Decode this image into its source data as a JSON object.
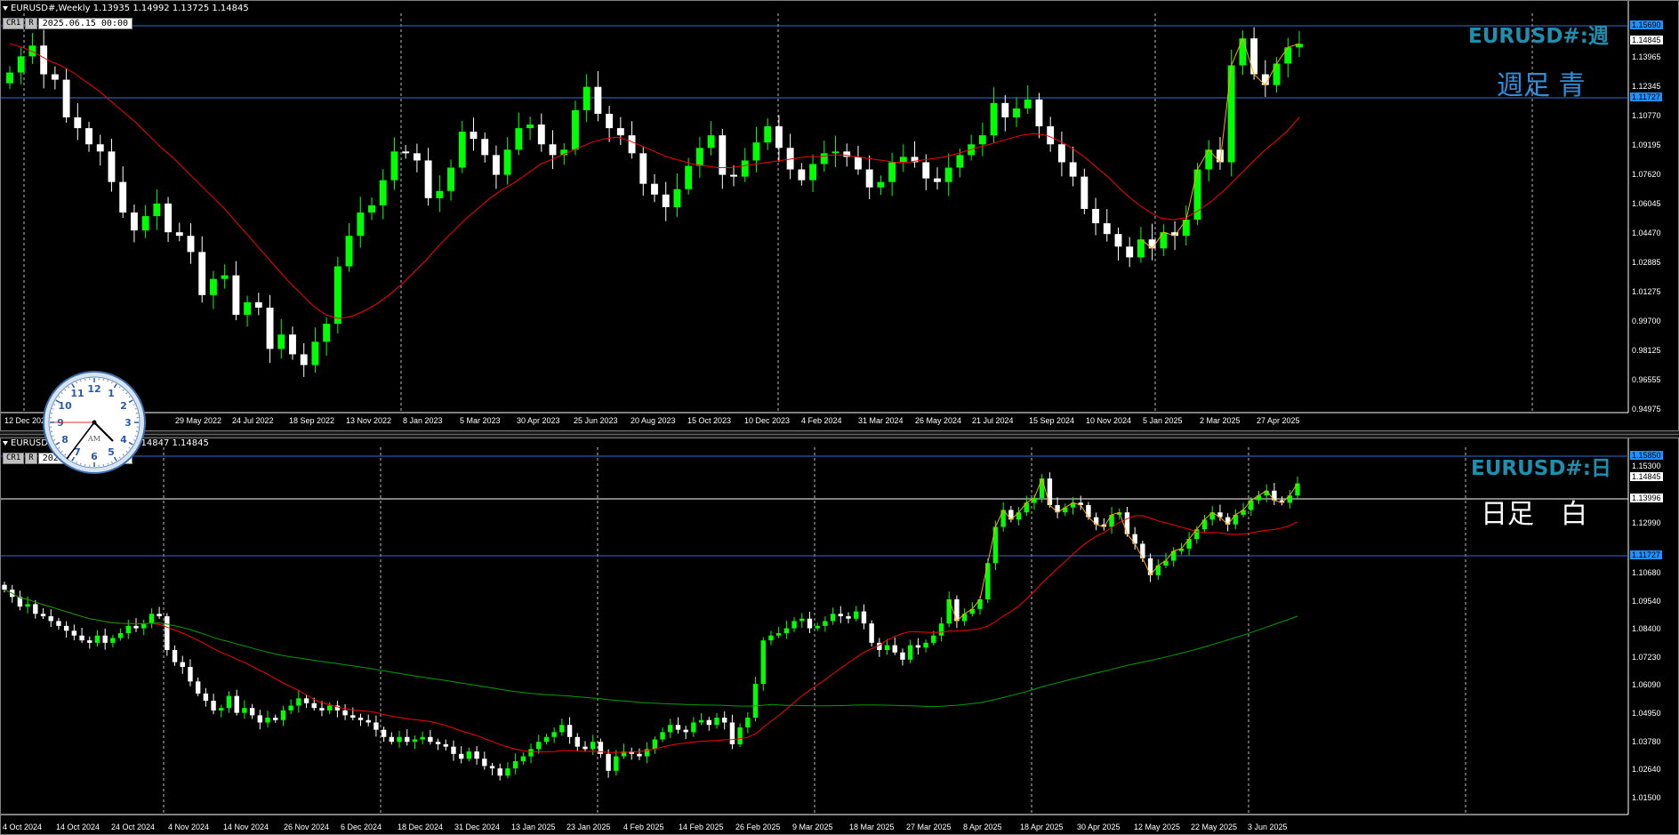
{
  "weekly": {
    "info": "EURUSD#,Weekly  1.13935 1.14992 1.13725 1.14845",
    "toolbar": {
      "btn1": "CR1",
      "btn2": "R",
      "date": "2025.06.15 00:00"
    },
    "symbol_title": "EURUSD#:週",
    "jp_label": "週足 青",
    "jp_label_color": "#2e8fdd",
    "price_labels": [
      "1.13965",
      "1.12345",
      "1.10770",
      "1.09195",
      "1.07620",
      "1.06045",
      "1.04470",
      "1.02885",
      "1.01275",
      "0.99700",
      "0.98125",
      "0.96555",
      "0.94975"
    ],
    "tags": {
      "high": "1.15690",
      "current": "1.14845",
      "low": "1.11727"
    },
    "date_labels": [
      "12 Dec 2021",
      "22",
      "29 May 2022",
      "24 Jul 2022",
      "18 Sep 2022",
      "13 Nov 2022",
      "8 Jan 2023",
      "5 Mar 2023",
      "30 Apr 2023",
      "25 Jun 2023",
      "20 Aug 2023",
      "15 Oct 2023",
      "10 Dec 2023",
      "4 Feb 2024",
      "31 Mar 2024",
      "26 May 2024",
      "21 Jul 2024",
      "15 Sep 2024",
      "10 Nov 2024",
      "5 Jan 2025",
      "2 Mar 2025",
      "27 Apr 2025"
    ],
    "chart_data": {
      "type": "candlestick",
      "bull_color": "#00ff00",
      "bear_color": "#ffffff",
      "ma_color": "#ff0000",
      "zigzag_color": "#ffa500",
      "series": [
        {
          "name": "close",
          "values": [
            1.132,
            1.141,
            1.147,
            1.131,
            1.128,
            1.107,
            1.101,
            1.092,
            1.088,
            1.071,
            1.054,
            1.044,
            1.052,
            1.059,
            1.043,
            1.041,
            1.032,
            1.008,
            1.017,
            1.019,
            0.997,
            1.004,
            1.001,
            0.978,
            0.986,
            0.975,
            0.969,
            0.982,
            0.992,
            1.024,
            1.041,
            1.054,
            1.058,
            1.072,
            1.088,
            1.087,
            1.083,
            1.062,
            1.066,
            1.079,
            1.099,
            1.095,
            1.086,
            1.075,
            1.089,
            1.101,
            1.103,
            1.092,
            1.086,
            1.089,
            1.111,
            1.124,
            1.109,
            1.101,
            1.097,
            1.087,
            1.07,
            1.064,
            1.057,
            1.067,
            1.08,
            1.09,
            1.097,
            1.075,
            1.074,
            1.083,
            1.093,
            1.102,
            1.09,
            1.078,
            1.072,
            1.081,
            1.087,
            1.088,
            1.085,
            1.078,
            1.068,
            1.071,
            1.082,
            1.085,
            1.082,
            1.073,
            1.071,
            1.079,
            1.086,
            1.092,
            1.097,
            1.115,
            1.107,
            1.112,
            1.117,
            1.102,
            1.092,
            1.082,
            1.074,
            1.056,
            1.048,
            1.042,
            1.035,
            1.029,
            1.039,
            1.034,
            1.043,
            1.041,
            1.05,
            1.078,
            1.089,
            1.082,
            1.136,
            1.151,
            1.131,
            1.125,
            1.137,
            1.146,
            1.148
          ]
        }
      ],
      "ma_values": [
        1.148,
        1.146,
        1.143,
        1.139,
        1.136,
        1.132,
        1.127,
        1.122,
        1.116,
        1.11,
        1.104,
        1.097,
        1.09,
        1.084,
        1.077,
        1.07,
        1.063,
        1.056,
        1.048,
        1.04,
        1.032,
        1.024,
        1.016,
        1.009,
        1.002,
        0.997,
        0.995,
        0.996,
        0.999,
        1.003,
        1.008,
        1.014,
        1.021,
        1.028,
        1.036,
        1.043,
        1.05,
        1.056,
        1.062,
        1.067,
        1.071,
        1.076,
        1.081,
        1.084,
        1.087,
        1.09,
        1.093,
        1.095,
        1.096,
        1.094,
        1.091,
        1.088,
        1.085,
        1.083,
        1.081,
        1.08,
        1.079,
        1.079,
        1.08,
        1.081,
        1.082,
        1.083,
        1.084,
        1.085,
        1.085,
        1.086,
        1.086,
        1.085,
        1.084,
        1.083,
        1.082,
        1.082,
        1.083,
        1.084,
        1.085,
        1.087,
        1.089,
        1.091,
        1.093,
        1.095,
        1.097,
        1.098,
        1.097,
        1.094,
        1.09,
        1.085,
        1.079,
        1.073,
        1.066,
        1.06,
        1.055,
        1.051,
        1.05,
        1.051,
        1.055,
        1.06,
        1.066,
        1.073,
        1.08,
        1.087,
        1.093,
        1.099,
        1.107
      ],
      "ylim": [
        0.944,
        1.161
      ]
    }
  },
  "daily": {
    "info_left": "EURUSD",
    "info_right": "1.14847 1.14845",
    "toolbar": {
      "btn1": "CR1",
      "btn2": "R",
      "date": "2025.06.18 00:00"
    },
    "symbol_title": "EURUSD#:日",
    "jp_label": "日足　白",
    "jp_label_color": "#ffffff",
    "price_labels": [
      "1.15300",
      "1.12990",
      "1.10680",
      "1.09540",
      "1.08400",
      "1.07230",
      "1.06090",
      "1.04950",
      "1.03780",
      "1.02640",
      "1.01500"
    ],
    "tags": {
      "high": "1.15850",
      "current": "1.14845",
      "white": "1.13996",
      "low": "1.11727"
    },
    "date_labels": [
      "4 Oct 2024",
      "14 Oct 2024",
      "24 Oct 2024",
      "4 Nov 2024",
      "14 Nov 2024",
      "26 Nov 2024",
      "6 Dec 2024",
      "18 Dec 2024",
      "31 Dec 2024",
      "13 Jan 2025",
      "23 Jan 2025",
      "4 Feb 2025",
      "14 Feb 2025",
      "26 Feb 2025",
      "9 Mar 2025",
      "18 Mar 2025",
      "27 Mar 2025",
      "8 Apr 2025",
      "18 Apr 2025",
      "30 Apr 2025",
      "12 May 2025",
      "22 May 2025",
      "3 Jun 2025"
    ],
    "chart_data": {
      "type": "candlestick",
      "bull_color": "#00ff00",
      "bear_color": "#ffffff",
      "ma_fast_color": "#ff0000",
      "ma_slow_color": "#00a000",
      "zigzag_color": "#ffa500",
      "series": [
        {
          "name": "close",
          "values": [
            1.104,
            1.101,
            1.097,
            1.098,
            1.094,
            1.093,
            1.091,
            1.089,
            1.087,
            1.085,
            1.083,
            1.082,
            1.085,
            1.082,
            1.084,
            1.086,
            1.089,
            1.088,
            1.09,
            1.094,
            1.093,
            1.079,
            1.074,
            1.072,
            1.066,
            1.061,
            1.058,
            1.054,
            1.055,
            1.06,
            1.053,
            1.055,
            1.052,
            1.049,
            1.051,
            1.05,
            1.054,
            1.056,
            1.059,
            1.057,
            1.055,
            1.054,
            1.056,
            1.054,
            1.052,
            1.051,
            1.05,
            1.049,
            1.046,
            1.043,
            1.041,
            1.043,
            1.041,
            1.042,
            1.043,
            1.041,
            1.04,
            1.039,
            1.036,
            1.034,
            1.037,
            1.034,
            1.031,
            1.03,
            1.027,
            1.03,
            1.033,
            1.035,
            1.038,
            1.041,
            1.043,
            1.045,
            1.048,
            1.043,
            1.039,
            1.038,
            1.041,
            1.036,
            1.029,
            1.035,
            1.037,
            1.036,
            1.035,
            1.038,
            1.042,
            1.045,
            1.048,
            1.046,
            1.045,
            1.049,
            1.05,
            1.048,
            1.051,
            1.049,
            1.04,
            1.047,
            1.051,
            1.065,
            1.083,
            1.085,
            1.086,
            1.088,
            1.091,
            1.092,
            1.088,
            1.089,
            1.091,
            1.094,
            1.093,
            1.092,
            1.095,
            1.09,
            1.082,
            1.079,
            1.081,
            1.078,
            1.075,
            1.081,
            1.08,
            1.082,
            1.085,
            1.09,
            1.1,
            1.091,
            1.094,
            1.096,
            1.1,
            1.115,
            1.13,
            1.137,
            1.133,
            1.136,
            1.14,
            1.142,
            1.15,
            1.139,
            1.136,
            1.138,
            1.14,
            1.139,
            1.134,
            1.131,
            1.13,
            1.135,
            1.136,
            1.127,
            1.123,
            1.117,
            1.11,
            1.114,
            1.116,
            1.12,
            1.121,
            1.125,
            1.129,
            1.133,
            1.136,
            1.134,
            1.131,
            1.135,
            1.137,
            1.141,
            1.143,
            1.145,
            1.141,
            1.14,
            1.143,
            1.148
          ]
        }
      ],
      "ylim": [
        1.012,
        1.16
      ]
    }
  },
  "clock": {
    "numbers": [
      "12",
      "1",
      "2",
      "3",
      "4",
      "5",
      "6",
      "7",
      "8",
      "9",
      "10",
      "11"
    ],
    "ampm": "AM"
  }
}
